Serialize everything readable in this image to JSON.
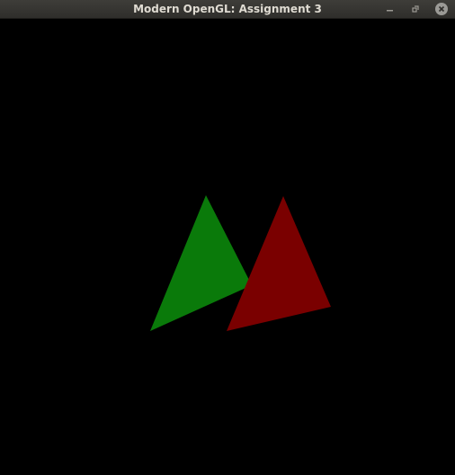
{
  "window": {
    "title": "Modern OpenGL: Assignment 3",
    "controls": {
      "minimize_icon": "minimize-icon",
      "maximize_icon": "restore-icon",
      "close_icon": "close-icon"
    }
  },
  "scene": {
    "background_color": "#000000",
    "triangles": [
      {
        "name": "green-triangle",
        "color": "#0a7a0a"
      },
      {
        "name": "red-triangle",
        "color": "#7a0000"
      }
    ]
  }
}
